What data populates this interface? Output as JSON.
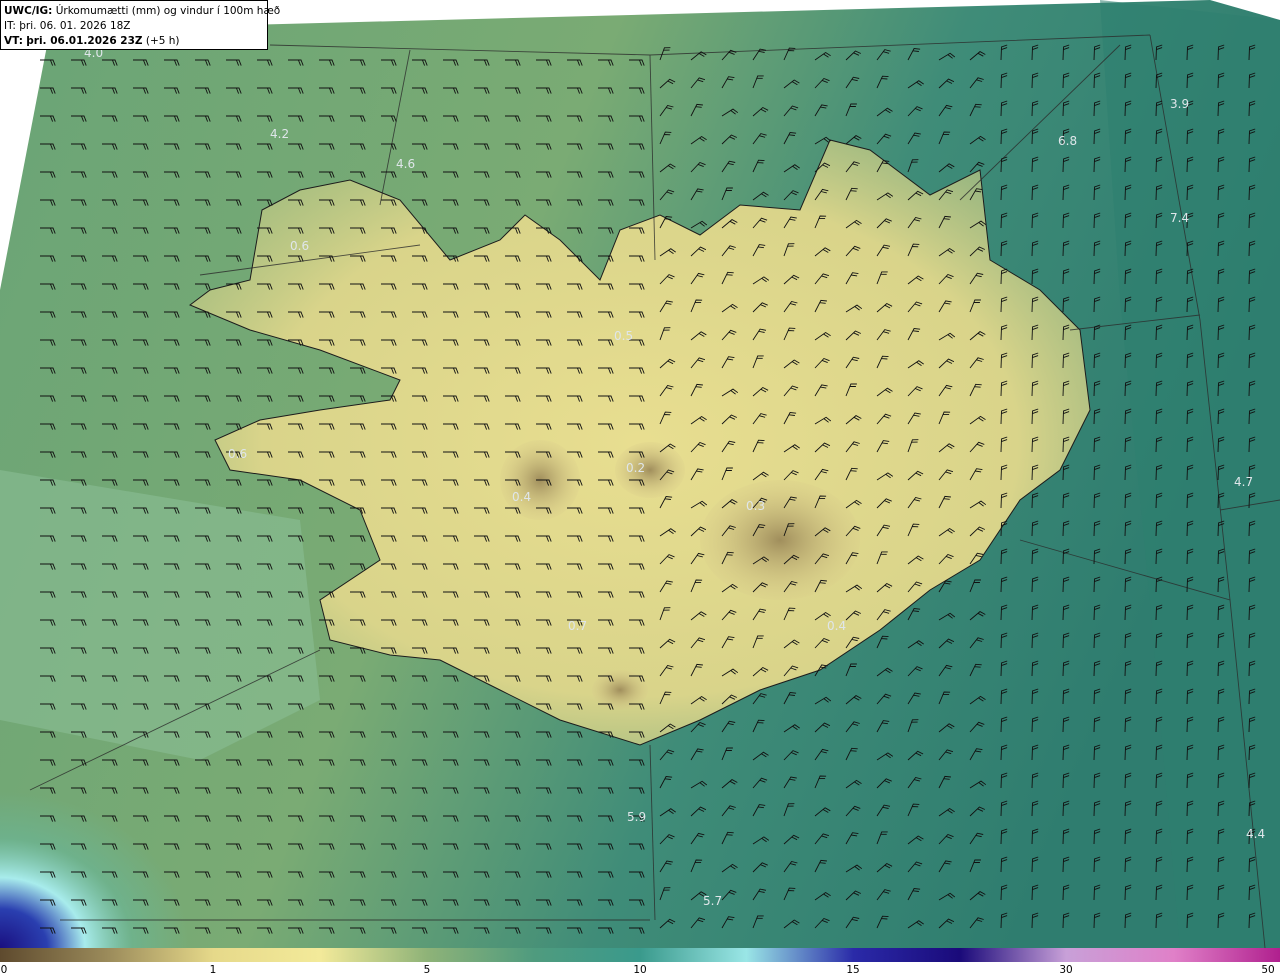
{
  "header": {
    "model": "UWC/IG:",
    "description": "Úrkomumætti (mm) og vindur í 100m hæð",
    "it_line": "IT: þri. 06. 01. 2026 18Z",
    "vt_prefix": "VT:",
    "vt_line": "þri. 06.01.2026 23Z",
    "vt_offset": "(+5 h)"
  },
  "point_labels": [
    "4.0",
    "4.2",
    "4.6",
    "6.8",
    "3.9",
    "7.4",
    "4.7",
    "4.4",
    "5.9",
    "5.7",
    "0.2",
    "0.4",
    "0.3",
    "0.7",
    "0.4",
    "0.6",
    "0.5",
    "0.6"
  ],
  "colorbar": {
    "ticks": [
      "0",
      "1",
      "5",
      "10",
      "15",
      "30",
      "50"
    ],
    "colors": [
      "#5e4a2e",
      "#9a8a5a",
      "#e6d98a",
      "#f3ea9a",
      "#8fb378",
      "#4f9b7e",
      "#3a9a8c",
      "#9ae6e6",
      "#2a2aa8",
      "#1a0a7a",
      "#c8a0d8",
      "#e080c8",
      "#b0208e"
    ]
  }
}
